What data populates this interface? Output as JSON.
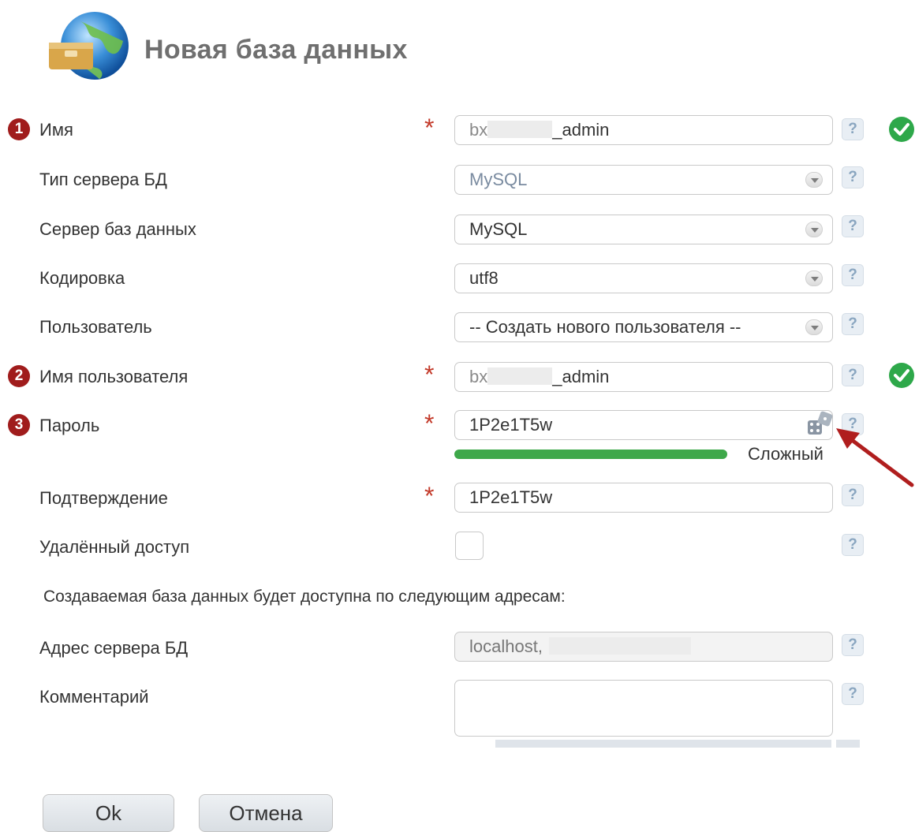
{
  "header": {
    "title": "Новая база данных"
  },
  "form": {
    "name": {
      "number": "1",
      "label": "Имя",
      "value_prefix": "bx",
      "value_suffix": "_admin"
    },
    "server_type": {
      "label": "Тип сервера БД",
      "value": "MySQL"
    },
    "db_server": {
      "label": "Сервер баз данных",
      "value": "MySQL"
    },
    "encoding": {
      "label": "Кодировка",
      "value": "utf8"
    },
    "user": {
      "label": "Пользователь",
      "value": "-- Создать нового пользователя --"
    },
    "username": {
      "number": "2",
      "label": "Имя пользователя",
      "value_prefix": "bx",
      "value_suffix": "_admin"
    },
    "password": {
      "number": "3",
      "label": "Пароль",
      "value": "1P2e1T5w",
      "strength_label": "Сложный",
      "strength_level": 1.0
    },
    "confirm": {
      "label": "Подтверждение",
      "value": "1P2e1T5w"
    },
    "remote_access": {
      "label": "Удалённый доступ",
      "checked": false
    },
    "info_text": "Создаваемая база данных будет доступна по следующим адресам:",
    "server_address": {
      "label": "Адрес сервера БД",
      "value": "localhost,"
    },
    "comment": {
      "label": "Комментарий",
      "value": ""
    },
    "required_mark": "*",
    "help_mark": "?"
  },
  "buttons": {
    "ok": "Ok",
    "cancel": "Отмена"
  },
  "colors": {
    "required": "#c33a2a",
    "success": "#2ea84a",
    "badge": "#a01c1c",
    "strength": "#3ea84a"
  }
}
